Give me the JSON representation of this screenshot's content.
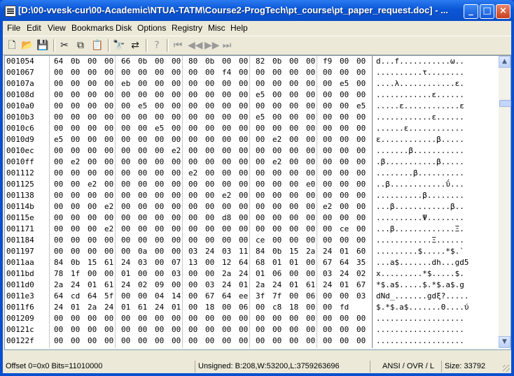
{
  "window": {
    "title": "[D:\\00-vvesk-cur\\00-Academic\\NTUA-TATM\\Course2-ProgTech\\pt_course\\pt_paper_request.doc] - ...",
    "buttons": {
      "minimize": "_",
      "maximize": "□",
      "close": "×"
    }
  },
  "menu": [
    "File",
    "Edit",
    "View",
    "Bookmarks",
    "Disk",
    "Options",
    "Registry",
    "Misc",
    "Help"
  ],
  "toolbar": [
    {
      "name": "new-icon",
      "glyph": "🗋",
      "enabled": true
    },
    {
      "name": "open-icon",
      "glyph": "📂",
      "enabled": true
    },
    {
      "name": "save-icon",
      "glyph": "💾",
      "enabled": true
    },
    {
      "name": "cut-icon",
      "glyph": "✂",
      "enabled": true
    },
    {
      "name": "copy-icon",
      "glyph": "⧉",
      "enabled": true
    },
    {
      "name": "paste-icon",
      "glyph": "📋",
      "enabled": true
    },
    {
      "name": "find-icon",
      "glyph": "🔭",
      "enabled": true
    },
    {
      "name": "replace-icon",
      "glyph": "⇄",
      "enabled": true
    },
    {
      "name": "help-icon",
      "glyph": "?",
      "enabled": false
    },
    {
      "name": "first-icon",
      "glyph": "⏮",
      "enabled": false
    },
    {
      "name": "prev-icon",
      "glyph": "◀◀",
      "enabled": false
    },
    {
      "name": "next-icon",
      "glyph": "▶▶",
      "enabled": false
    },
    {
      "name": "last-icon",
      "glyph": "⏭",
      "enabled": false
    }
  ],
  "hex_rows": [
    {
      "addr": "001054",
      "bytes": [
        "64",
        "0b",
        "00",
        "00",
        "66",
        "0b",
        "00",
        "00",
        "80",
        "0b",
        "00",
        "00",
        "82",
        "0b",
        "00",
        "00",
        "f9",
        "00",
        "00"
      ],
      "ascii": "d...f...........ω.."
    },
    {
      "addr": "001067",
      "bytes": [
        "00",
        "00",
        "00",
        "00",
        "00",
        "00",
        "00",
        "00",
        "00",
        "00",
        "f4",
        "00",
        "00",
        "00",
        "00",
        "00",
        "00",
        "00",
        "00"
      ],
      "ascii": "..........τ........"
    },
    {
      "addr": "00107a",
      "bytes": [
        "00",
        "00",
        "00",
        "00",
        "eb",
        "00",
        "00",
        "00",
        "00",
        "00",
        "00",
        "00",
        "00",
        "00",
        "00",
        "00",
        "00",
        "e5",
        "00"
      ],
      "ascii": "....λ............ε."
    },
    {
      "addr": "00108d",
      "bytes": [
        "00",
        "00",
        "00",
        "00",
        "00",
        "00",
        "00",
        "00",
        "00",
        "00",
        "00",
        "00",
        "e5",
        "00",
        "00",
        "00",
        "00",
        "00",
        "00"
      ],
      "ascii": "............ε......"
    },
    {
      "addr": "0010a0",
      "bytes": [
        "00",
        "00",
        "00",
        "00",
        "00",
        "e5",
        "00",
        "00",
        "00",
        "00",
        "00",
        "00",
        "00",
        "00",
        "00",
        "00",
        "00",
        "00",
        "e5"
      ],
      "ascii": ".....ε............ε"
    },
    {
      "addr": "0010b3",
      "bytes": [
        "00",
        "00",
        "00",
        "00",
        "00",
        "00",
        "00",
        "00",
        "00",
        "00",
        "00",
        "00",
        "e5",
        "00",
        "00",
        "00",
        "00",
        "00",
        "00"
      ],
      "ascii": "............ε......"
    },
    {
      "addr": "0010c6",
      "bytes": [
        "00",
        "00",
        "00",
        "00",
        "00",
        "00",
        "e5",
        "00",
        "00",
        "00",
        "00",
        "00",
        "00",
        "00",
        "00",
        "00",
        "00",
        "00",
        "00"
      ],
      "ascii": "......ε............"
    },
    {
      "addr": "0010d9",
      "bytes": [
        "e5",
        "00",
        "00",
        "00",
        "00",
        "00",
        "00",
        "00",
        "00",
        "00",
        "00",
        "00",
        "00",
        "e2",
        "00",
        "00",
        "00",
        "00",
        "00"
      ],
      "ascii": "ε............β....."
    },
    {
      "addr": "0010ec",
      "bytes": [
        "00",
        "00",
        "00",
        "00",
        "00",
        "00",
        "00",
        "e2",
        "00",
        "00",
        "00",
        "00",
        "00",
        "00",
        "00",
        "00",
        "00",
        "00",
        "00"
      ],
      "ascii": ".......β..........."
    },
    {
      "addr": "0010ff",
      "bytes": [
        "00",
        "e2",
        "00",
        "00",
        "00",
        "00",
        "00",
        "00",
        "00",
        "00",
        "00",
        "00",
        "00",
        "e2",
        "00",
        "00",
        "00",
        "00",
        "00"
      ],
      "ascii": ".β...........β....."
    },
    {
      "addr": "001112",
      "bytes": [
        "00",
        "00",
        "00",
        "00",
        "00",
        "00",
        "00",
        "00",
        "e2",
        "00",
        "00",
        "00",
        "00",
        "00",
        "00",
        "00",
        "00",
        "00",
        "00"
      ],
      "ascii": "........β.........."
    },
    {
      "addr": "001125",
      "bytes": [
        "00",
        "00",
        "e2",
        "00",
        "00",
        "00",
        "00",
        "00",
        "00",
        "00",
        "00",
        "00",
        "00",
        "00",
        "00",
        "e0",
        "00",
        "00",
        "00"
      ],
      "ascii": "..β............ΰ..."
    },
    {
      "addr": "001138",
      "bytes": [
        "00",
        "00",
        "00",
        "00",
        "00",
        "00",
        "00",
        "00",
        "00",
        "00",
        "e2",
        "00",
        "00",
        "00",
        "00",
        "00",
        "00",
        "00",
        "00"
      ],
      "ascii": "..........β........"
    },
    {
      "addr": "00114b",
      "bytes": [
        "00",
        "00",
        "00",
        "e2",
        "00",
        "00",
        "00",
        "00",
        "00",
        "00",
        "00",
        "00",
        "00",
        "00",
        "00",
        "00",
        "e2",
        "00",
        "00"
      ],
      "ascii": "...β............β.."
    },
    {
      "addr": "00115e",
      "bytes": [
        "00",
        "00",
        "00",
        "00",
        "00",
        "00",
        "00",
        "00",
        "00",
        "00",
        "d8",
        "00",
        "00",
        "00",
        "00",
        "00",
        "00",
        "00",
        "00"
      ],
      "ascii": "..........Ψ........"
    },
    {
      "addr": "001171",
      "bytes": [
        "00",
        "00",
        "00",
        "e2",
        "00",
        "00",
        "00",
        "00",
        "00",
        "00",
        "00",
        "00",
        "00",
        "00",
        "00",
        "00",
        "00",
        "ce",
        "00"
      ],
      "ascii": "...β.............Ξ."
    },
    {
      "addr": "001184",
      "bytes": [
        "00",
        "00",
        "00",
        "00",
        "00",
        "00",
        "00",
        "00",
        "00",
        "00",
        "00",
        "00",
        "ce",
        "00",
        "00",
        "00",
        "00",
        "00",
        "00"
      ],
      "ascii": "............Ξ......"
    },
    {
      "addr": "001197",
      "bytes": [
        "00",
        "00",
        "00",
        "00",
        "00",
        "0a",
        "00",
        "00",
        "03",
        "24",
        "03",
        "11",
        "84",
        "0b",
        "15",
        "2a",
        "24",
        "01",
        "60"
      ],
      "ascii": ".........$.....*$.`"
    },
    {
      "addr": "0011aa",
      "bytes": [
        "84",
        "0b",
        "15",
        "61",
        "24",
        "03",
        "00",
        "07",
        "13",
        "00",
        "12",
        "64",
        "68",
        "01",
        "01",
        "00",
        "67",
        "64",
        "35"
      ],
      "ascii": "...a$.......dh...gd5"
    },
    {
      "addr": "0011bd",
      "bytes": [
        "78",
        "1f",
        "00",
        "00",
        "01",
        "00",
        "00",
        "03",
        "00",
        "00",
        "2a",
        "24",
        "01",
        "06",
        "00",
        "00",
        "03",
        "24",
        "02"
      ],
      "ascii": "x.........*$.....$."
    },
    {
      "addr": "0011d0",
      "bytes": [
        "2a",
        "24",
        "01",
        "61",
        "24",
        "02",
        "09",
        "00",
        "00",
        "03",
        "24",
        "01",
        "2a",
        "24",
        "01",
        "61",
        "24",
        "01",
        "67"
      ],
      "ascii": "*$.a$.....$.*$.a$.g"
    },
    {
      "addr": "0011e3",
      "bytes": [
        "64",
        "cd",
        "64",
        "5f",
        "00",
        "00",
        "04",
        "14",
        "00",
        "67",
        "64",
        "ee",
        "3f",
        "7f",
        "00",
        "06",
        "00",
        "00",
        "03"
      ],
      "ascii": "dNd_.......gdξ?....."
    },
    {
      "addr": "0011f6",
      "bytes": [
        "24",
        "01",
        "2a",
        "24",
        "01",
        "61",
        "24",
        "01",
        "00",
        "18",
        "00",
        "06",
        "00",
        "c8",
        "18",
        "00",
        "00",
        "fd"
      ],
      "ascii": "$.*$.a$.......Θ....ύ"
    },
    {
      "addr": "001209",
      "bytes": [
        "00",
        "00",
        "00",
        "00",
        "00",
        "00",
        "00",
        "00",
        "00",
        "00",
        "00",
        "00",
        "00",
        "00",
        "00",
        "00",
        "00",
        "00",
        "00"
      ],
      "ascii": "..................."
    },
    {
      "addr": "00121c",
      "bytes": [
        "00",
        "00",
        "00",
        "00",
        "00",
        "00",
        "00",
        "00",
        "00",
        "00",
        "00",
        "00",
        "00",
        "00",
        "00",
        "00",
        "00",
        "00",
        "00"
      ],
      "ascii": "..................."
    },
    {
      "addr": "00122f",
      "bytes": [
        "00",
        "00",
        "00",
        "00",
        "00",
        "00",
        "00",
        "00",
        "00",
        "00",
        "00",
        "00",
        "00",
        "00",
        "00",
        "00",
        "00",
        "00",
        "00"
      ],
      "ascii": "..................."
    }
  ],
  "scroll": {
    "up": "▲",
    "down": "▼",
    "position": 0.15
  },
  "status": {
    "offset": "Offset 0=0x0  Bits=11010000",
    "unsigned": "Unsigned: B:208,W:53200,L:3759263696",
    "mode": "ANSI / OVR / L",
    "size": "Size: 33792"
  }
}
